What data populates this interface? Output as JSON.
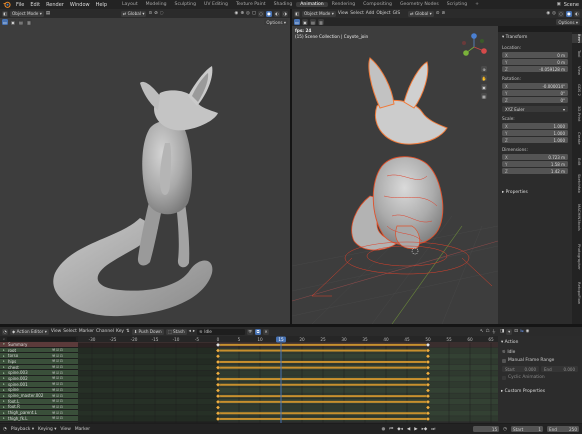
{
  "topbar": {
    "menus": [
      "File",
      "Edit",
      "Render",
      "Window",
      "Help"
    ],
    "workspaces": [
      "Layout",
      "Modeling",
      "Sculpting",
      "UV Editing",
      "Texture Paint",
      "Shading",
      "Animation",
      "Rendering",
      "Compositing",
      "Geometry Nodes",
      "Scripting"
    ],
    "active_workspace": "Animation",
    "scene_label": "Scene"
  },
  "left_viewport": {
    "mode": "Object Mode",
    "orientation": "Global",
    "options": "Options"
  },
  "right_viewport": {
    "mode": "Object Mode",
    "menus": [
      "View",
      "Select",
      "Add",
      "Object",
      "GIS"
    ],
    "orientation": "Global",
    "options": "Options",
    "overlay_line1": "fps: 24",
    "overlay_line2": "(15) Scene Collection | Coyote_join"
  },
  "npanel": {
    "section": "Transform",
    "location_label": "Location:",
    "location": [
      {
        "axis": "X",
        "value": "0 m"
      },
      {
        "axis": "Y",
        "value": "0 m"
      },
      {
        "axis": "Z",
        "value": "-0.059128 m"
      }
    ],
    "rotation_label": "Rotation:",
    "rotation": [
      {
        "axis": "X",
        "value": "-0.000014°"
      },
      {
        "axis": "Y",
        "value": "0°"
      },
      {
        "axis": "Z",
        "value": "0°"
      }
    ],
    "rotation_mode": "XYZ Euler",
    "scale_label": "Scale:",
    "scale": [
      {
        "axis": "X",
        "value": "1.000"
      },
      {
        "axis": "Y",
        "value": "1.000"
      },
      {
        "axis": "Z",
        "value": "1.000"
      }
    ],
    "dimensions_label": "Dimensions:",
    "dimensions": [
      {
        "axis": "X",
        "value": "0.723 m"
      },
      {
        "axis": "Y",
        "value": "1.58 m"
      },
      {
        "axis": "Z",
        "value": "1.42 m"
      }
    ],
    "properties_label": "Properties",
    "tabs": [
      "Item",
      "Tool",
      "View",
      "GDS 2",
      "3D-Print",
      "Create",
      "Edit",
      "Sketchfab",
      "MACHIN3tools",
      "Photographer",
      "RetopoFlow"
    ]
  },
  "action_editor": {
    "editor_type": "Action Editor",
    "menus": [
      "View",
      "Select",
      "Marker",
      "Channel",
      "Key"
    ],
    "push_down": "Push Down",
    "stash": "Stash",
    "action_name": "Idle",
    "frame_ticks": [
      "-30",
      "-25",
      "-20",
      "-15",
      "-10",
      "-5",
      "0",
      "5",
      "10",
      "15",
      "20",
      "25",
      "30",
      "35",
      "40",
      "45",
      "50",
      "55",
      "60",
      "65"
    ],
    "current_frame": "15",
    "channels": [
      "Summary",
      "root",
      "torso",
      "hips",
      "chest",
      "spine.003",
      "spine.002",
      "spine.001",
      "spine",
      "spine_master.002",
      "foot.L",
      "foot.R",
      "thigh_parent.L",
      "thigh_fk.L"
    ],
    "side_panel": {
      "action_section": "Action",
      "action_name": "Idle",
      "manual_frame_range": "Manual Frame Range",
      "start_label": "Start",
      "start_value": "0.000",
      "end_label": "End",
      "end_value": "0.000",
      "cyclic": "Cyclic Animation",
      "custom_properties": "Custom Properties"
    }
  },
  "statusbar": {
    "playback": "Playback",
    "keying": "Keying",
    "view": "View",
    "marker": "Marker",
    "frame": "15",
    "start_label": "Start",
    "start_value": "1",
    "end_label": "End",
    "end_value": "250"
  }
}
